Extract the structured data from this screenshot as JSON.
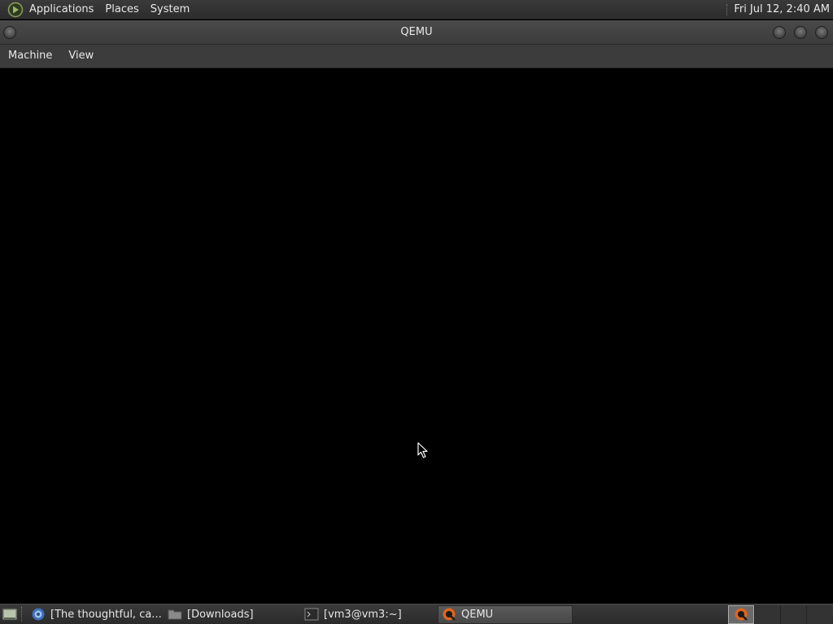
{
  "top_panel": {
    "menus": [
      "Applications",
      "Places",
      "System"
    ],
    "clock": "Fri Jul 12,  2:40 AM"
  },
  "window": {
    "title": "QEMU",
    "menubar": [
      "Machine",
      "View"
    ]
  },
  "taskbar": {
    "tasks": [
      {
        "label": "[The thoughtful, ca...",
        "icon": "browser-icon",
        "active": false
      },
      {
        "label": "[Downloads]",
        "icon": "folder-icon",
        "active": false
      },
      {
        "label": "[vm3@vm3:~]",
        "icon": "terminal-icon",
        "active": false
      },
      {
        "label": "QEMU",
        "icon": "qemu-icon",
        "active": true
      }
    ],
    "workspaces": {
      "count": 4,
      "active_index": 0
    }
  },
  "colors": {
    "panel_bg": "#2e2e2e",
    "titlebar_bg": "#444444",
    "display_bg": "#000000",
    "qemu_accent": "#e0651c"
  }
}
